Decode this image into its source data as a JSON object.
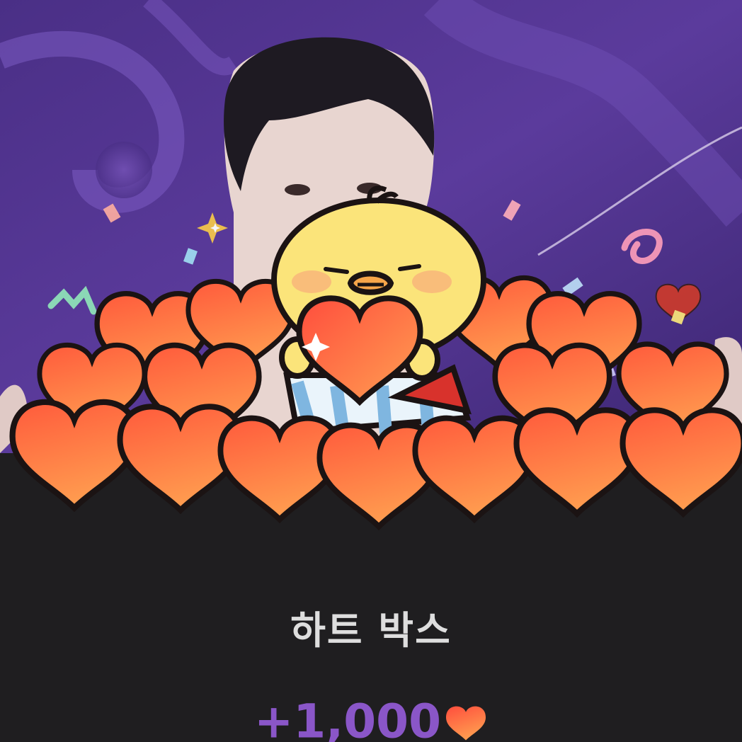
{
  "gift": {
    "name": "하트 박스",
    "amount": "+1,000",
    "currency_icon": "heart-icon"
  },
  "colors": {
    "panel_bg": "#1f1e20",
    "title": "#dedede",
    "amount": "#8a56c8",
    "heart_top": "#ff9a4a",
    "heart_bottom": "#ff4a3a",
    "background_purple": "#5a3a98"
  }
}
